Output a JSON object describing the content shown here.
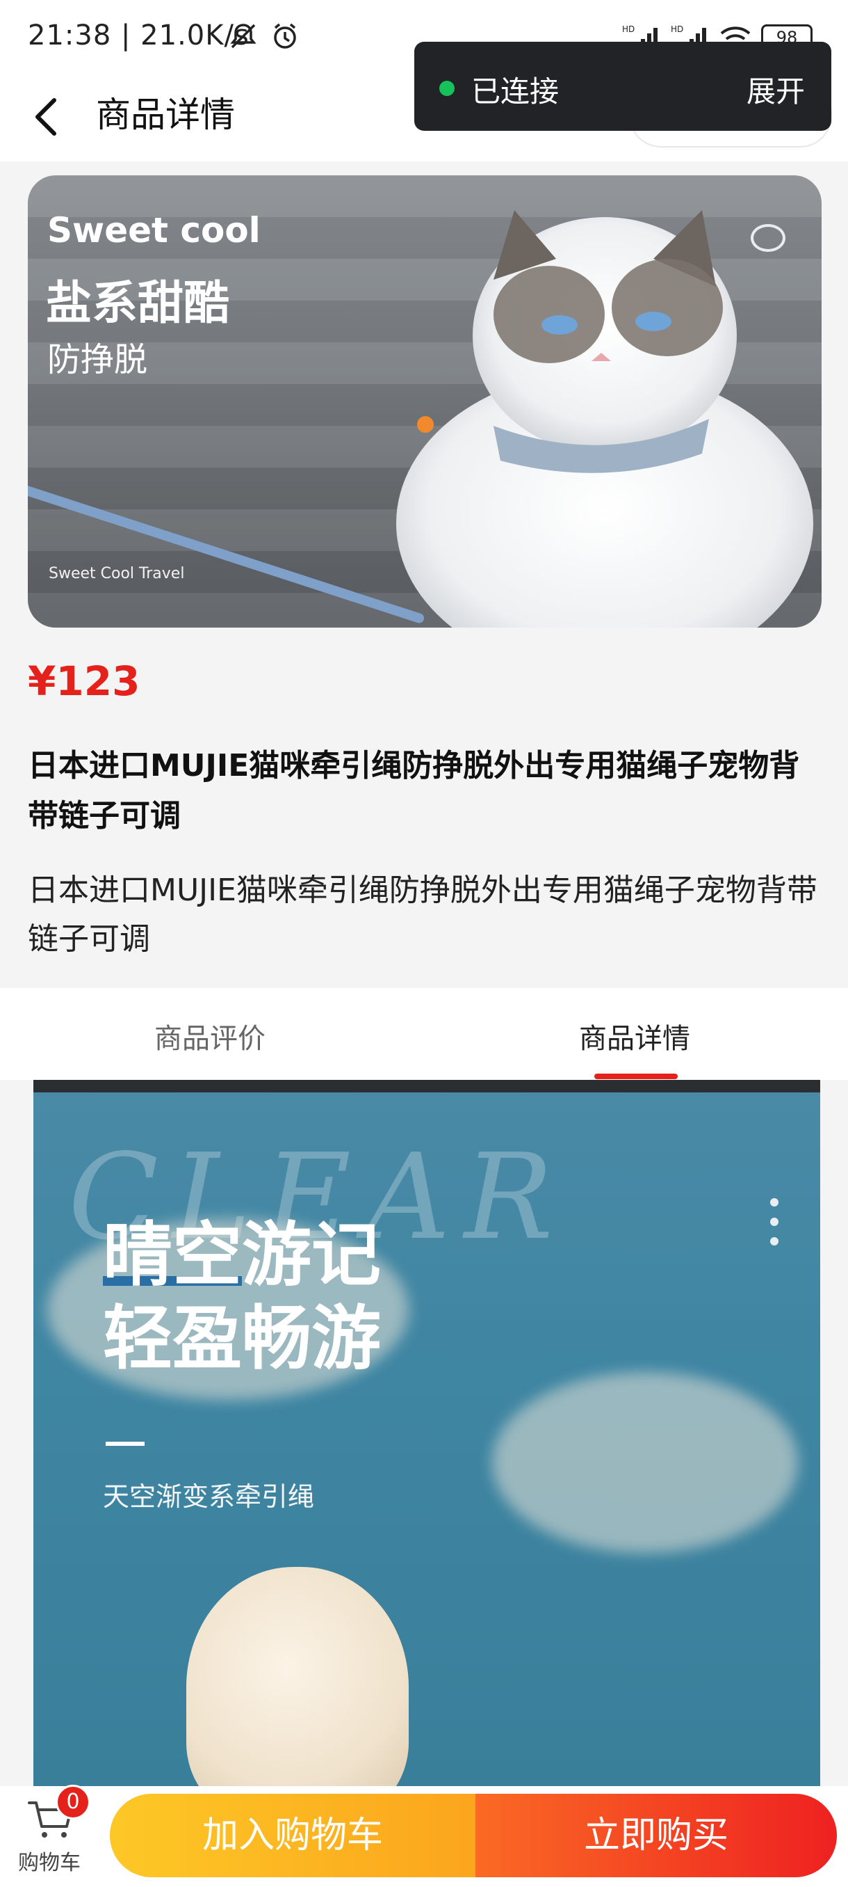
{
  "status_bar": {
    "time_speed": "21:38 | 21.0K/s",
    "battery": "98",
    "icons": [
      "mute-icon",
      "alarm-icon",
      "hd-signal-icon",
      "hd-signal-icon",
      "wifi-icon",
      "battery-icon"
    ]
  },
  "header": {
    "title": "商品详情",
    "back_icon": "chevron-left-icon",
    "capsule_icons": [
      "more-dots-icon",
      "target-icon"
    ]
  },
  "toast": {
    "status": "已连接",
    "action": "展开",
    "status_color": "#18c25a"
  },
  "carousel": {
    "banner_en": "Sweet cool",
    "banner_cn": "盐系甜酷",
    "banner_sub": "防挣脱",
    "banner_footer": "Sweet Cool Travel",
    "indicator_color": "#f08a2c"
  },
  "product": {
    "price": "¥123",
    "title": "日本进口MUJIE猫咪牵引绳防挣脱外出专用猫绳子宠物背带链子可调",
    "description": "日本进口MUJIE猫咪牵引绳防挣脱外出专用猫绳子宠物背带链子可调",
    "price_color": "#e4211a"
  },
  "tabs": {
    "items": [
      {
        "label": "商品评价",
        "active": false
      },
      {
        "label": "商品详情",
        "active": true
      }
    ],
    "active_color": "#e4211a"
  },
  "detail_image": {
    "watermark": "CLEAR",
    "line1": "晴空游记",
    "line2": "轻盈畅游",
    "subtitle": "天空渐变系牵引绳"
  },
  "bottom_bar": {
    "cart_label": "购物车",
    "cart_count": "0",
    "add_to_cart": "加入购物车",
    "buy_now": "立即购买"
  }
}
